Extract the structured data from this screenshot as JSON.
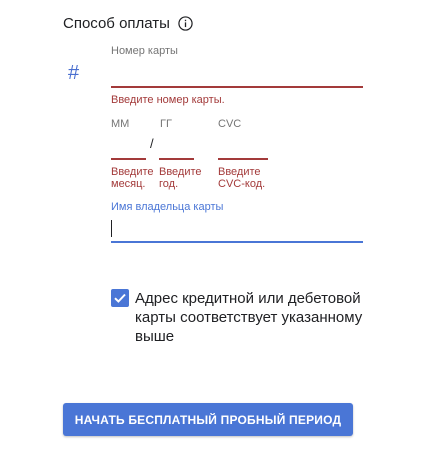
{
  "payment": {
    "title": "Способ оплаты",
    "info_icon": "info-circle-icon",
    "card_icon": "hash-icon"
  },
  "card_number": {
    "label": "Номер карты",
    "value": "",
    "error": "Введите номер карты."
  },
  "expiry": {
    "month_label": "ММ",
    "year_label": "ГГ",
    "separator": "/",
    "month_value": "",
    "year_value": "",
    "month_error": "Введите месяц.",
    "year_error": "Введите год."
  },
  "cvc": {
    "label": "CVC",
    "value": "",
    "error": "Введите CVC-код."
  },
  "cardholder": {
    "label": "Имя владельца карты",
    "value": ""
  },
  "address_match": {
    "checked": true,
    "label": "Адрес кредитной или дебетовой карты соответствует указанному выше"
  },
  "submit": {
    "label": "НАЧАТЬ БЕСПЛАТНЫЙ ПРОБНЫЙ ПЕРИОД"
  },
  "colors": {
    "accent": "#4a76d6",
    "error": "#a33a3a",
    "label": "#757575",
    "text": "#202124"
  }
}
